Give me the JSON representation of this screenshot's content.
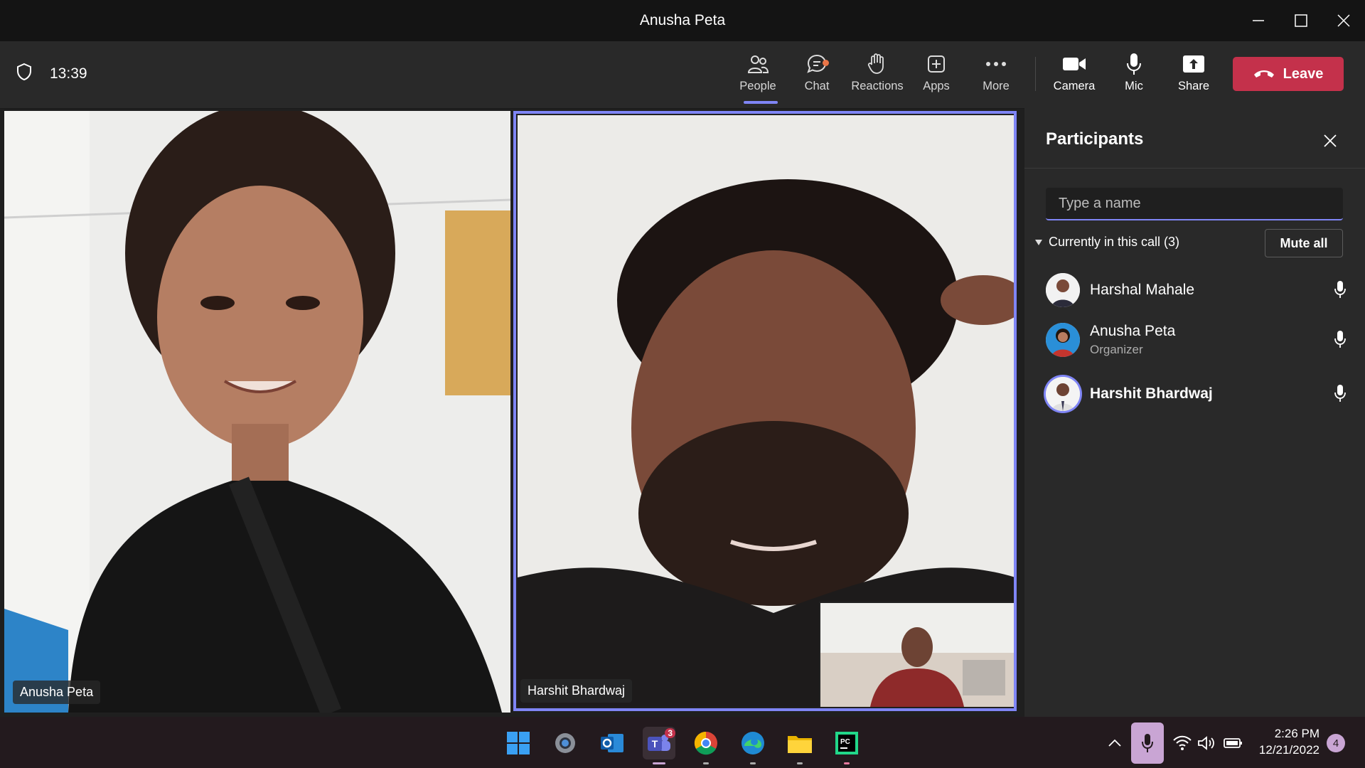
{
  "window": {
    "title": "Anusha Peta"
  },
  "toolbar": {
    "timer": "13:39",
    "people_label": "People",
    "chat_label": "Chat",
    "reactions_label": "Reactions",
    "apps_label": "Apps",
    "more_label": "More",
    "camera_label": "Camera",
    "mic_label": "Mic",
    "share_label": "Share",
    "leave_label": "Leave",
    "accent_color": "#7f85f5",
    "leave_color": "#c4314b"
  },
  "videos": {
    "tile1_name": "Anusha Peta",
    "tile2_name": "Harshit Bhardwaj"
  },
  "panel": {
    "title": "Participants",
    "search_placeholder": "Type a name",
    "section_label": "Currently in this call (3)",
    "mute_all_label": "Mute all",
    "participants": [
      {
        "name": "Harshal Mahale",
        "role": ""
      },
      {
        "name": "Anusha Peta",
        "role": "Organizer"
      },
      {
        "name": "Harshit Bhardwaj",
        "role": ""
      }
    ]
  },
  "taskbar": {
    "teams_badge": "3",
    "time": "2:26 PM",
    "date": "12/21/2022",
    "notification_count": "4",
    "apps": [
      "windows-start",
      "settings",
      "outlook",
      "teams",
      "chrome",
      "edge",
      "file-explorer",
      "pycharm"
    ]
  }
}
